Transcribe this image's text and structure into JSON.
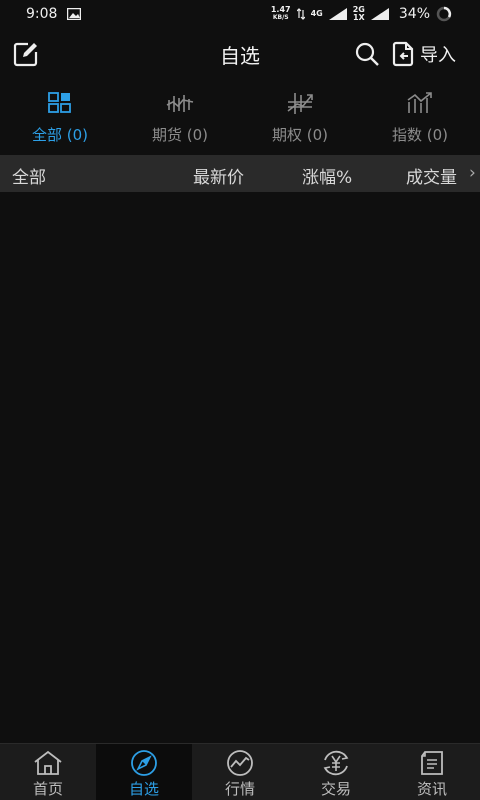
{
  "status_bar": {
    "time": "9:08",
    "speed_value": "1.47",
    "speed_unit": "KB/S",
    "net1": "4G",
    "net2_top": "2G",
    "net2_bottom": "1X",
    "battery": "34%"
  },
  "header": {
    "title": "自选",
    "import_label": "导入",
    "icons": [
      "edit-icon",
      "search-icon",
      "import-icon"
    ]
  },
  "tabs": [
    {
      "label": "全部 (0)",
      "icon": "grid-icon",
      "active": true
    },
    {
      "label": "期货 (0)",
      "icon": "futures-icon",
      "active": false
    },
    {
      "label": "期权 (0)",
      "icon": "options-icon",
      "active": false
    },
    {
      "label": "指数 (0)",
      "icon": "index-icon",
      "active": false
    }
  ],
  "columns": {
    "all": "全部",
    "price": "最新价",
    "change": "涨幅%",
    "volume": "成交量",
    "more": "›"
  },
  "bottom_nav": [
    {
      "label": "首页",
      "icon": "home-icon",
      "active": false
    },
    {
      "label": "自选",
      "icon": "compass-icon",
      "active": true
    },
    {
      "label": "行情",
      "icon": "market-icon",
      "active": false
    },
    {
      "label": "交易",
      "icon": "trade-icon",
      "active": false
    },
    {
      "label": "资讯",
      "icon": "news-icon",
      "active": false
    }
  ],
  "colors": {
    "accent": "#2d9fe6",
    "background": "#0f0f0f",
    "column_header_bg": "#2a2a2a",
    "inactive_text": "#8c8c8c"
  }
}
